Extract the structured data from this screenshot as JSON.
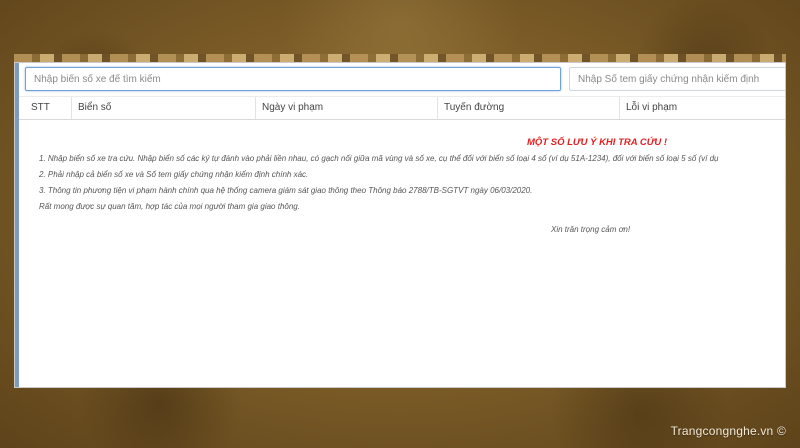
{
  "search": {
    "plate_placeholder": "Nhập biển số xe để tìm kiếm",
    "cert_placeholder": "Nhập Số tem giấy chứng nhận kiểm định"
  },
  "table": {
    "columns": [
      "STT",
      "Biển số",
      "Ngày vi phạm",
      "Tuyến đường",
      "Lỗi vi phạm"
    ]
  },
  "notes": {
    "title": "MỘT SỐ LƯU Ý KHI TRA CỨU !",
    "lines": [
      "1. Nhập biển số xe tra cứu. Nhập biển số các ký tự đánh vào phải liền nhau, có gạch nối giữa mã vùng và số xe, cụ thể đối với biển số loại 4 số (ví dụ 51A-1234), đối với biển số loại 5 số (ví dụ",
      "2. Phải nhập cả biển số xe và Số tem giấy chứng nhận kiểm định chính xác.",
      "3. Thông tin phương tiện vi phạm hành chính qua hệ thống camera giám sát giao thông theo Thông báo 2788/TB-SGTVT ngày 06/03/2020.",
      "Rất mong được sự quan tâm, hợp tác của mọi người tham gia giao thông."
    ],
    "signoff": "Xin trân trọng cảm ơn!"
  },
  "watermark": "Trangcongnghe.vn ©",
  "colors": {
    "notes_title": "#e02020",
    "focused_input_border": "#6fa3d8",
    "background_brown": "#7e5f29"
  }
}
